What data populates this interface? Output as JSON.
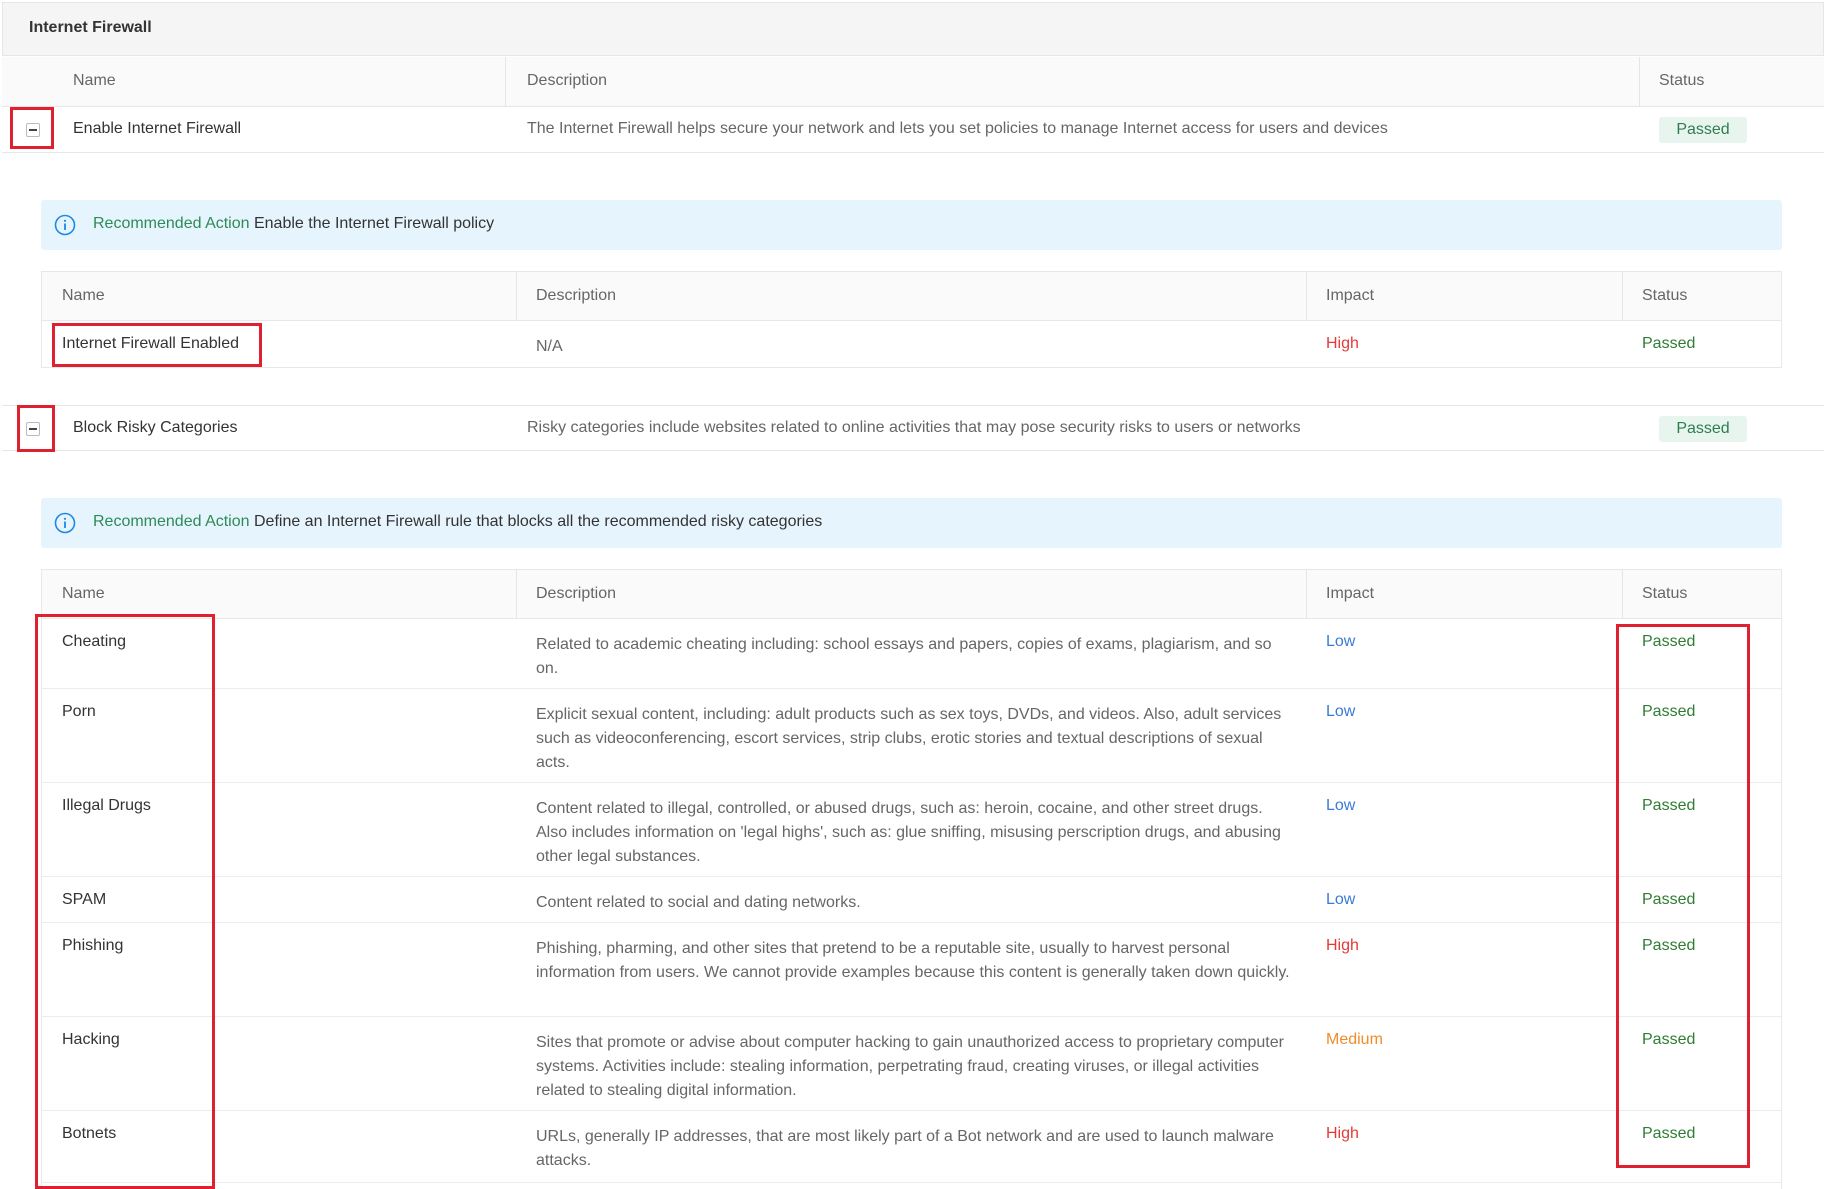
{
  "section": {
    "title": "Internet Firewall"
  },
  "outer_headers": {
    "name": "Name",
    "description": "Description",
    "status": "Status"
  },
  "rows": [
    {
      "name": "Enable Internet Firewall",
      "description": "The Internet Firewall helps secure your network and lets you set policies to manage Internet access for users and devices",
      "status": "Passed",
      "recommended_label": "Recommended Action",
      "recommended_action": "Enable the Internet Firewall policy"
    },
    {
      "name": "Block Risky Categories",
      "description": "Risky categories include websites related to online activities that may pose security risks to users or networks",
      "status": "Passed",
      "recommended_label": "Recommended Action",
      "recommended_action": "Define an Internet Firewall rule that blocks all the recommended risky categories"
    }
  ],
  "inner_headers": {
    "name": "Name",
    "description": "Description",
    "impact": "Impact",
    "status": "Status"
  },
  "firewall_checks": [
    {
      "name": "Internet Firewall Enabled",
      "description": "N/A",
      "impact": "High",
      "status": "Passed"
    }
  ],
  "risky_categories": [
    {
      "name": "Cheating",
      "description": "Related to academic cheating including: school essays and papers, copies of exams, plagiarism, and so on.",
      "impact": "Low",
      "status": "Passed"
    },
    {
      "name": "Porn",
      "description": "Explicit sexual content, including: adult products such as sex toys, DVDs, and videos. Also, adult services such as videoconferencing, escort services, strip clubs, erotic stories and textual descriptions of sexual acts.",
      "impact": "Low",
      "status": "Passed"
    },
    {
      "name": "Illegal Drugs",
      "description": "Content related to illegal, controlled, or abused drugs, such as: heroin, cocaine, and other street drugs. Also includes information on 'legal highs', such as: glue sniffing, misusing perscription drugs, and abusing other legal substances.",
      "impact": "Low",
      "status": "Passed"
    },
    {
      "name": "SPAM",
      "description": "Content related to social and dating networks.",
      "impact": "Low",
      "status": "Passed"
    },
    {
      "name": "Phishing",
      "description": "Phishing, pharming, and other sites that pretend to be a reputable site, usually to harvest personal information from users. We cannot provide examples because this content is generally taken down quickly.",
      "impact": "High",
      "status": "Passed"
    },
    {
      "name": "Hacking",
      "description": "Sites that promote or advise about computer hacking to gain unauthorized access to proprietary computer systems. Activities include: stealing information, perpetrating fraud, creating viruses, or illegal activities related to stealing digital information.",
      "impact": "Medium",
      "status": "Passed"
    },
    {
      "name": "Botnets",
      "description": "URLs, generally IP addresses, that are most likely part of a Bot network and are used to launch malware attacks.",
      "impact": "High",
      "status": "Passed"
    }
  ],
  "colors": {
    "passed": "#2e7d32",
    "high": "#e53935",
    "low": "#3a7bd5",
    "medium": "#f08c2a",
    "highlight": "#e0202e",
    "banner_bg": "#e6f4fd"
  }
}
